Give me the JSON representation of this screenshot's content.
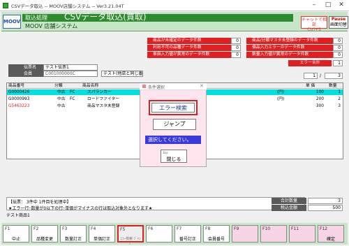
{
  "window": {
    "title": "CSVデータ取込 -- MOOV店舗システム -- Ver3.21.04T"
  },
  "banner": {
    "section": "取込処理",
    "title": "CSVデータ取込(買取)",
    "subtitle": "MOOV 店舗システム",
    "logo": "MOOV",
    "chat_btn": [
      "チャットで相談",
      "Ctrl+S"
    ],
    "pause_btn": [
      "Pause",
      "画面切替"
    ]
  },
  "counters": {
    "left": [
      {
        "label": "商品が未確定のデータ件数",
        "value": "0"
      },
      {
        "label": "利用不可の品種データ件数",
        "value": "0"
      },
      {
        "label": "単価入力値が異常のデータ件数",
        "value": "0"
      }
    ],
    "right": [
      {
        "label": "商品/分類マスタ未登録のデータ件数",
        "value": "0"
      },
      {
        "label": "個品入力エラーのデータ件数",
        "value": "0"
      },
      {
        "label": "数量入力値が異常のデータ件数",
        "value": "0"
      }
    ],
    "error_label": "エラー合計",
    "error_value": "1"
  },
  "slip": {
    "no_label": "伝票名",
    "no_value": "テスト伝票1",
    "member_label": "会員",
    "member_value": "C001000000C",
    "member_note": "テスト(他店と同じ番号"
  },
  "pager": {
    "current": "1",
    "sep": "/",
    "total": "3"
  },
  "grid": {
    "headers": [
      "商品番号",
      "分類",
      "商品名称",
      "単 価",
      "数量"
    ],
    "rows": [
      {
        "code": "G0000426",
        "cls": "中古",
        "cls2": "FC",
        "name": "スパランカー",
        "note": "(円)",
        "price": "100",
        "qty": "1",
        "selected": true,
        "code_color": "#000"
      },
      {
        "code": "G0000993",
        "cls": "中古",
        "cls2": "FC",
        "name": "ロードファイター",
        "note": "(円)",
        "price": "200",
        "qty": "2",
        "selected": false,
        "code_color": "#000"
      },
      {
        "code": "G5463223",
        "cls": "中古",
        "cls2": "",
        "name": "商品マスタ未登録",
        "note": "",
        "price": "300",
        "qty": "3",
        "selected": false,
        "code_color": "#e02020"
      }
    ]
  },
  "dialog": {
    "title": "条件選択",
    "error_search": "エラー検索",
    "jump": "ジャンプ",
    "prompt": "選択してください。",
    "close_key": "Esc",
    "close": "閉じる"
  },
  "message": {
    "line1": "【伝票： 3件中 1件目を処理中】",
    "line2": "★エラー行･数量が0以下の行･単価がマイナスの行は取込対象外となります★",
    "line3": "テスト商品1"
  },
  "totals": {
    "qty_label": "合計数量",
    "qty_value": "3",
    "amount_label": "税込金額",
    "amount_value": "500"
  },
  "fkeys": [
    {
      "key": "F1",
      "label": "中止"
    },
    {
      "key": "F2",
      "label": "品種変更"
    },
    {
      "key": "F3",
      "label": "数量訂正"
    },
    {
      "key": "F4",
      "label": "単価訂正"
    },
    {
      "key": "F5",
      "label": "ｴﾗｰ検索 ｼﾞｬﾝﾌﾟ"
    },
    {
      "key": "F6",
      "label": ""
    },
    {
      "key": "F7",
      "label": "番号訂正"
    },
    {
      "key": "F8",
      "label": "会員番号"
    },
    {
      "key": "F9",
      "label": ""
    },
    {
      "key": "F10",
      "label": ""
    },
    {
      "key": "F11",
      "label": ""
    },
    {
      "key": "F12",
      "label": "確定"
    }
  ],
  "colors": {
    "accent_green": "#2e8b2e",
    "error_red": "#e02020",
    "selected_row": "#00e0e0"
  }
}
